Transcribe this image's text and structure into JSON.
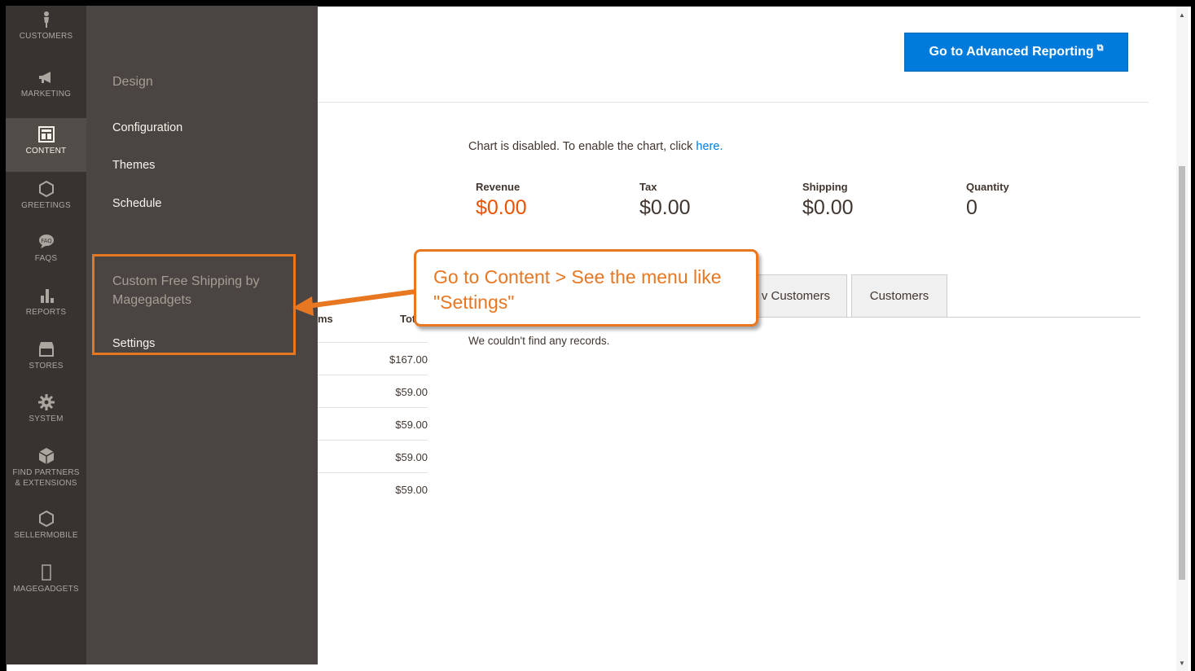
{
  "sidebar": {
    "items": [
      {
        "label": "CUSTOMERS",
        "icon": "person-icon"
      },
      {
        "label": "MARKETING",
        "icon": "megaphone-icon"
      },
      {
        "label": "CONTENT",
        "icon": "layout-icon",
        "active": true
      },
      {
        "label": "GREETINGS",
        "icon": "hexagon-icon"
      },
      {
        "label": "FAQS",
        "icon": "faq-bubble-icon"
      },
      {
        "label": "REPORTS",
        "icon": "bar-chart-icon"
      },
      {
        "label": "STORES",
        "icon": "storefront-icon"
      },
      {
        "label": "SYSTEM",
        "icon": "gear-icon"
      },
      {
        "label": "FIND PARTNERS & EXTENSIONS",
        "icon": "box-icon"
      },
      {
        "label": "SELLERMOBILE",
        "icon": "hexagon-icon"
      },
      {
        "label": "MAGEGADGETS",
        "icon": "rectangle-icon"
      }
    ]
  },
  "submenu": {
    "design_title": "Design",
    "links": [
      "Configuration",
      "Themes",
      "Schedule"
    ],
    "custom_title": "Custom Free Shipping by Magegadgets",
    "settings_label": "Settings"
  },
  "header": {
    "advanced_reporting_label": "Go to Advanced Reporting"
  },
  "dashboard": {
    "chart_message": "Chart is disabled. To enable the chart, click ",
    "chart_link": "here.",
    "totals": [
      {
        "key": "Revenue",
        "value": "$0.00"
      },
      {
        "key": "Tax",
        "value": "$0.00"
      },
      {
        "key": "Shipping",
        "value": "$0.00"
      },
      {
        "key": "Quantity",
        "value": "0"
      }
    ],
    "tabs": [
      "v Customers",
      "Customers"
    ],
    "no_records": "We couldn't find any records.",
    "grid_headers": [
      "ms",
      "Tot"
    ],
    "grid_values": [
      "$167.00",
      "$59.00",
      "$59.00",
      "$59.00",
      "$59.00"
    ]
  },
  "callout": {
    "line1": "Go to Content > See the menu like",
    "line2": "\"Settings\""
  },
  "colors": {
    "accent": "#e87722",
    "button": "#007bdb",
    "revenue": "#eb5202",
    "rail": "#373330",
    "submenu": "#4a4542"
  }
}
